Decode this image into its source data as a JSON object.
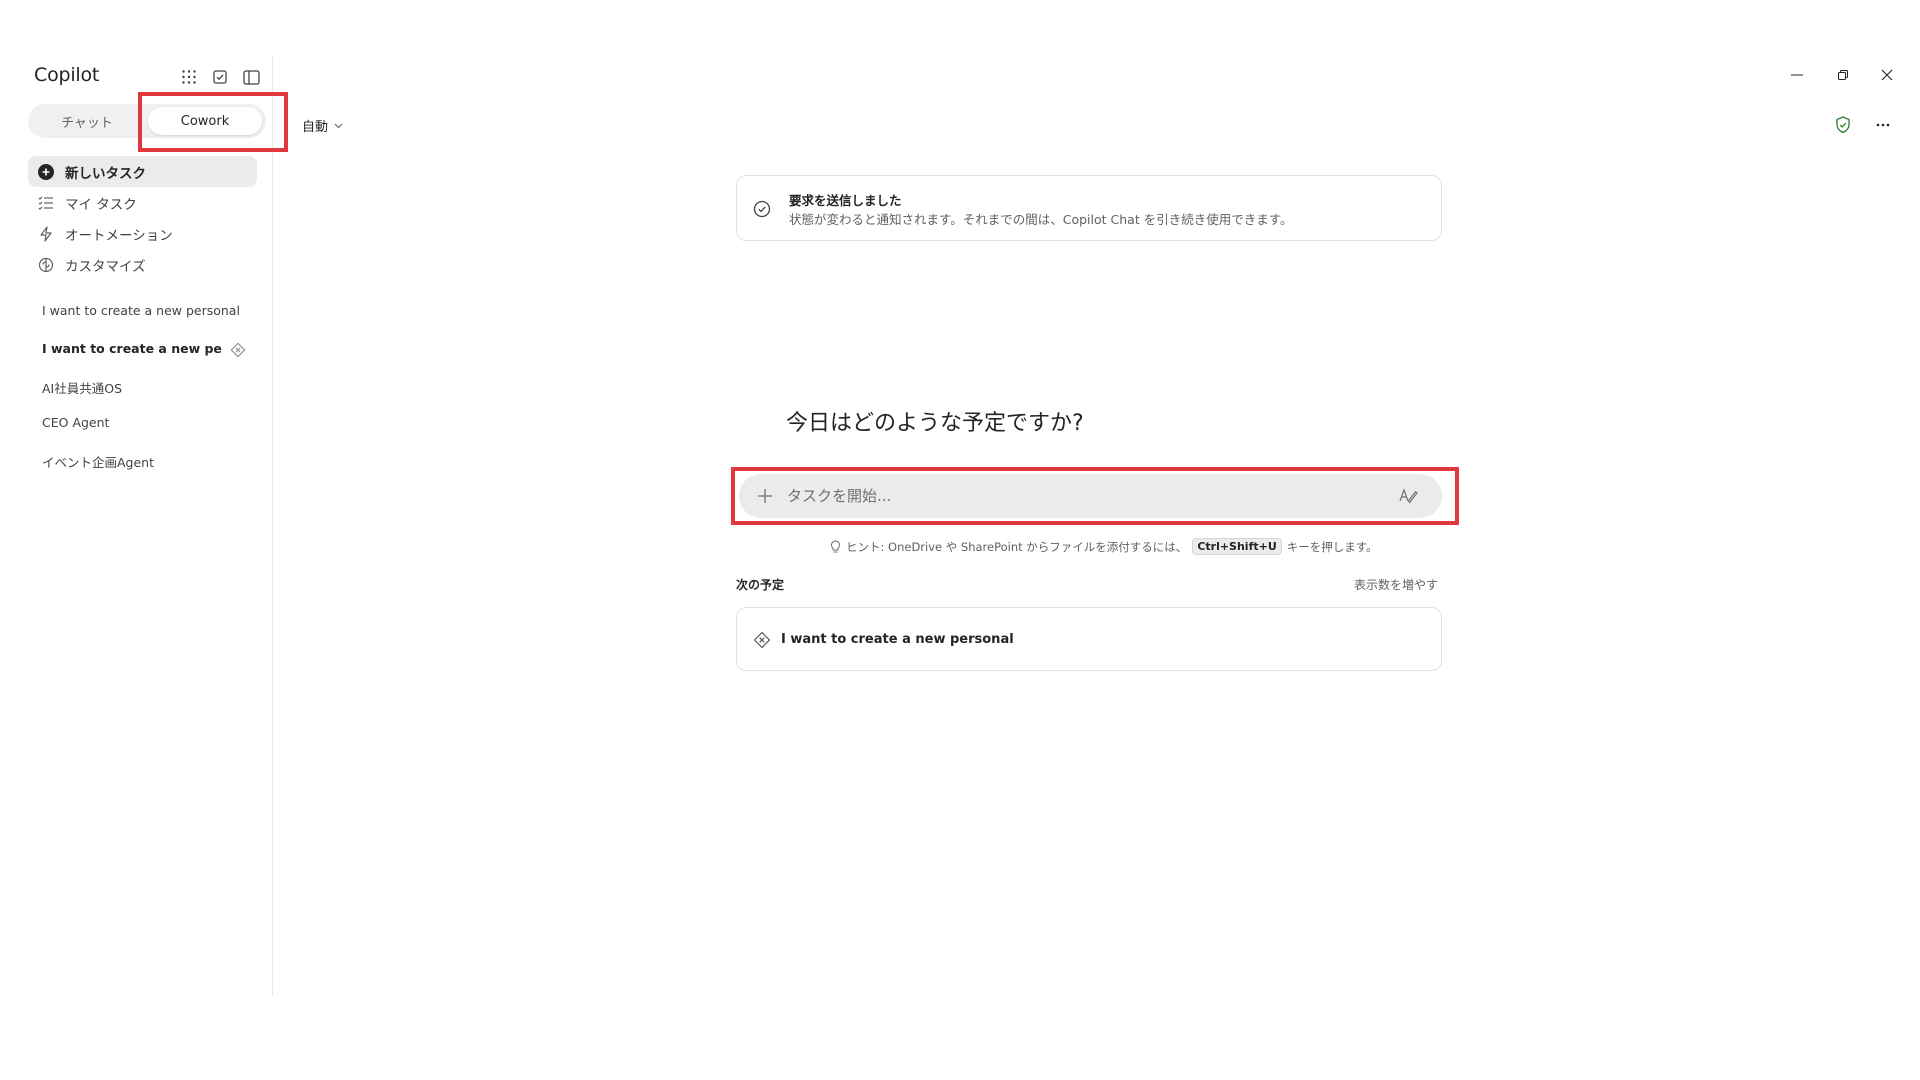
{
  "app": {
    "title": "Copilot"
  },
  "mode_tabs": {
    "chat": "チャット",
    "cowork": "Cowork"
  },
  "nav": [
    {
      "label": "新しいタスク",
      "icon": "plus-circle-icon"
    },
    {
      "label": "マイ タスク",
      "icon": "list-icon"
    },
    {
      "label": "オートメーション",
      "icon": "lightning-icon"
    },
    {
      "label": "カスタマイズ",
      "icon": "brain-icon"
    }
  ],
  "recent": [
    {
      "label": "I want to create a new personal"
    },
    {
      "label": "I want to create a new per..."
    },
    {
      "label": "AI社員共通OS"
    },
    {
      "label": "CEO Agent"
    },
    {
      "label": "イベント企画Agent"
    }
  ],
  "topbar": {
    "mode": "自動"
  },
  "notice": {
    "title": "要求を送信しました",
    "body": "状態が変わると通知されます。それまでの間は、Copilot Chat を引き続き使用できます。"
  },
  "main": {
    "greeting": "今日はどのような予定ですか?",
    "input_placeholder": "タスクを開始...",
    "hint_prefix": "ヒント: OneDrive や SharePoint からファイルを添付するには、",
    "hint_key": "Ctrl+Shift+U",
    "hint_suffix": "キーを押します。",
    "upcoming_header": "次の予定",
    "show_more": "表示数を増やす",
    "upcoming_item": "I want to create a new personal"
  },
  "colors": {
    "highlight": "#e0383c",
    "accent_green": "#2e7d32"
  }
}
